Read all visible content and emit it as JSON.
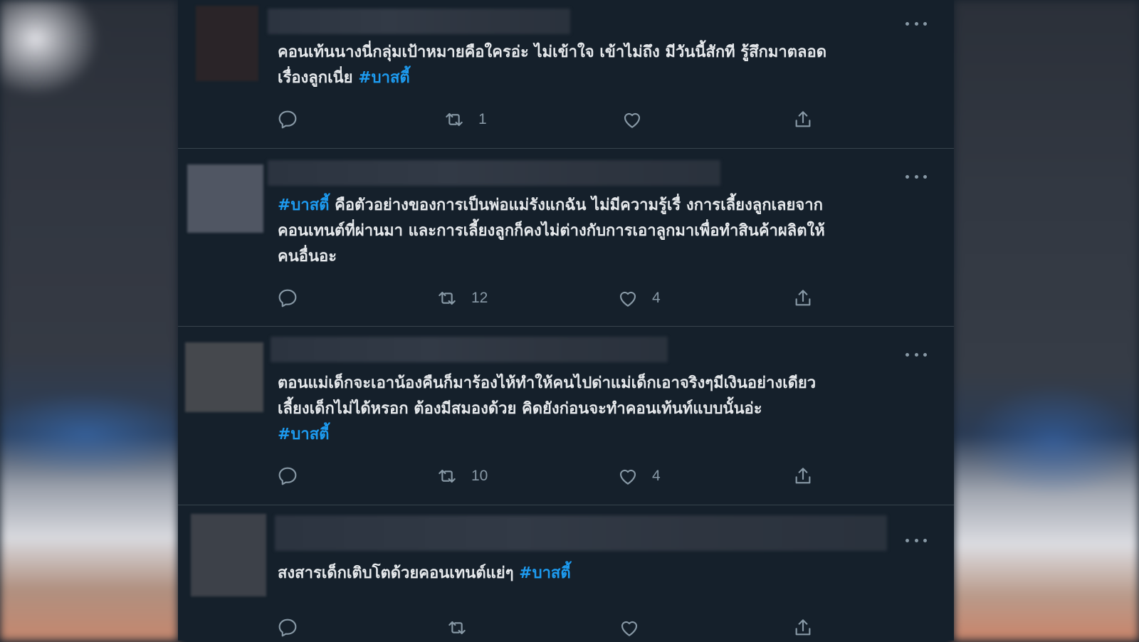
{
  "hashtag_color": "#1d9bf0",
  "tweets": [
    {
      "text_before": "คอนเท้นนางนี่กลุ่มเป้าหมายคือใครอ่ะ ไม่เข้าใจ เข้าไม่ถึง มีวันนี้สักที รู้สึกมาตลอด\nเรื่องลูกเนี่ย ",
      "hashtag": "#บาสตี้",
      "text_after": "",
      "retweets": "1",
      "likes": ""
    },
    {
      "text_before": "",
      "hashtag": "#บาสตี้",
      "text_after": " คือตัวอย่างของการเป็นพ่อแม่รังแกฉัน ไม่มีความรู้เรื่ งการเลี้ยงลูกเลยจาก\nคอนเทนต์ที่ผ่านมา และการเลี้ยงลูกก็คงไม่ต่างกับการเอาลูกมาเพื่อทำสินค้าผลิตให้\nคนอื่นอะ",
      "retweets": "12",
      "likes": "4"
    },
    {
      "text_before": "ตอนแม่เด็กจะเอาน้องคืนก็มาร้องไห้ทำให้คนไปด่าแม่เด็กเอาจริงๆมีเงินอย่างเดียว\nเลี้ยงเด็กไม่ได้หรอก ต้องมีสมองด้วย คิดยังก่อนจะทำคอนเท้นท์แบบนั้นอ่ะ\n",
      "hashtag": "#บาสตี้",
      "text_after": "",
      "retweets": "10",
      "likes": "4"
    },
    {
      "text_before": "สงสารเด็กเติบโตด้วยคอนเทนต์แย่ๆ ",
      "hashtag": "#บาสตี้",
      "text_after": "",
      "retweets": "",
      "likes": ""
    }
  ]
}
